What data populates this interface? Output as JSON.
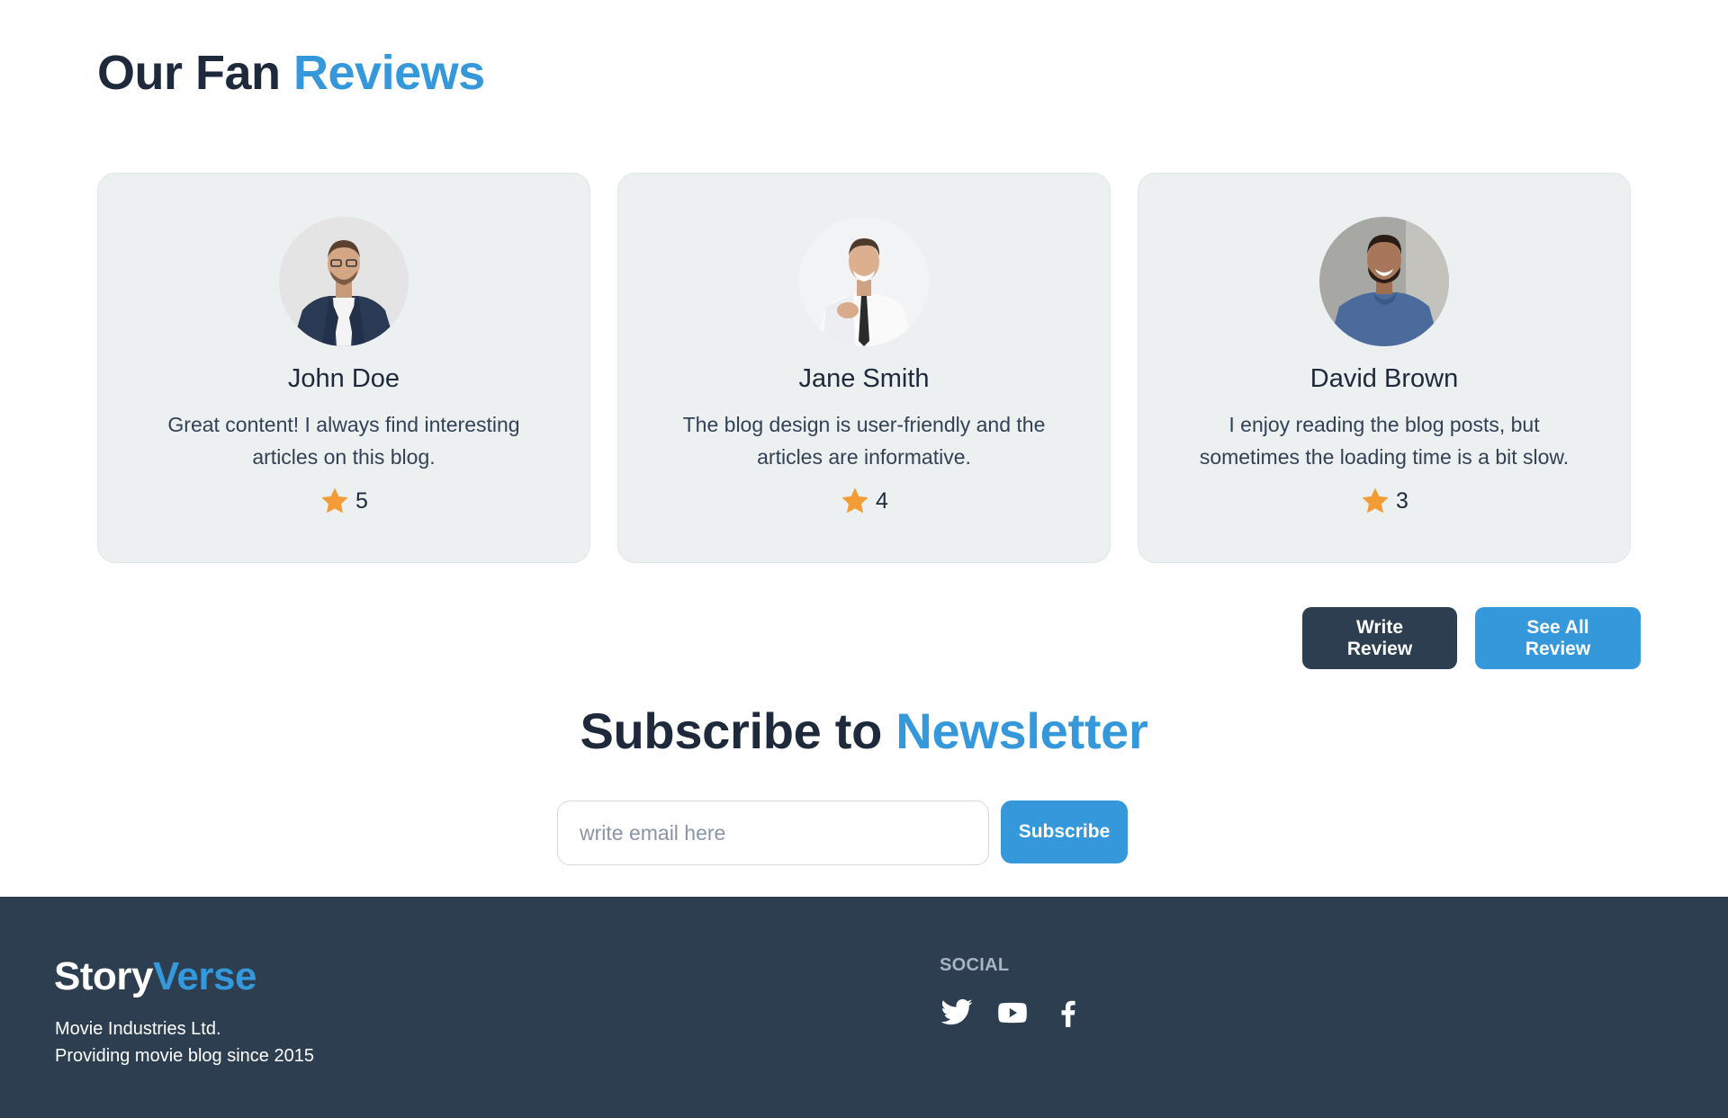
{
  "reviews": {
    "title_main": "Our Fan",
    "title_accent": "Reviews",
    "items": [
      {
        "name": "John Doe",
        "text": "Great content! I always find interesting articles on this blog.",
        "rating": "5"
      },
      {
        "name": "Jane Smith",
        "text": "The blog design is user-friendly and the articles are informative.",
        "rating": "4"
      },
      {
        "name": "David Brown",
        "text": "I enjoy reading the blog posts, but sometimes the loading time is a bit slow.",
        "rating": "3"
      }
    ],
    "write_label": "Write Review",
    "see_all_label": "See All Review"
  },
  "newsletter": {
    "title_main": "Subscribe to",
    "title_accent": "Newsletter",
    "placeholder": "write email here",
    "button_label": "Subscribe"
  },
  "footer": {
    "brand_main": "Story",
    "brand_accent": "Verse",
    "company": "Movie Industries Ltd.",
    "tagline": "Providing movie blog since 2015",
    "social_heading": "SOCIAL",
    "social_icons": [
      "twitter-icon",
      "youtube-icon",
      "facebook-icon"
    ]
  },
  "colors": {
    "accent": "#3498db",
    "dark": "#2c3e50",
    "card_bg": "#ecf0f1",
    "star": "#f39c35"
  }
}
